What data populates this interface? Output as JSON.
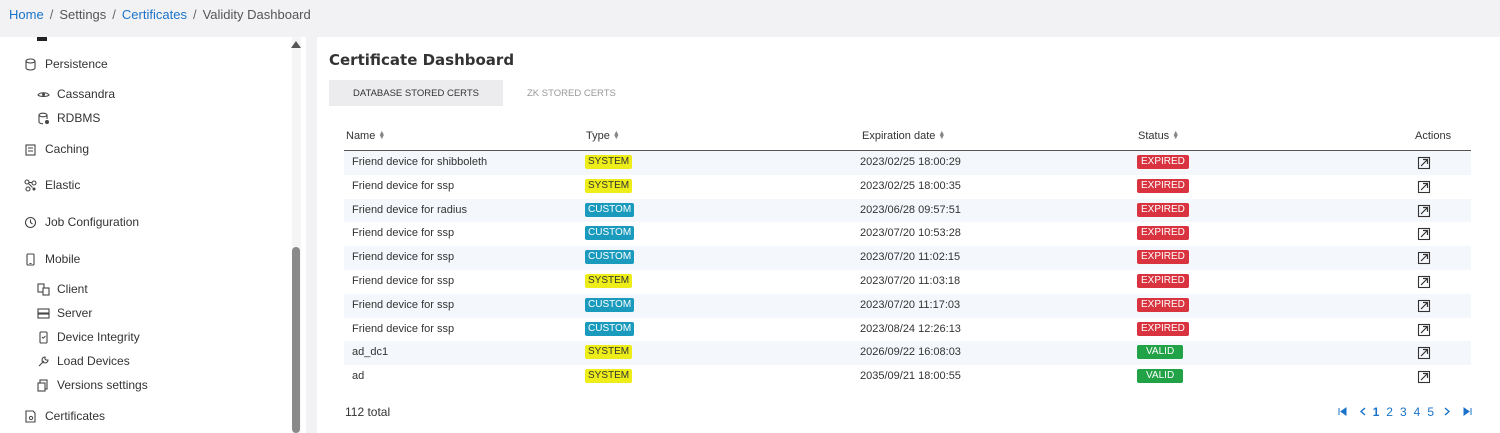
{
  "breadcrumb": {
    "home": "Home",
    "settings": "Settings",
    "certificates": "Certificates",
    "current": "Validity Dashboard",
    "separator": "/"
  },
  "sidebar": {
    "items": [
      {
        "label": "Persistence",
        "icon": "database-icon"
      },
      {
        "label": "Cassandra",
        "icon": "eye-icon"
      },
      {
        "label": "RDBMS",
        "icon": "rdbms-icon"
      },
      {
        "label": "Caching",
        "icon": "caching-icon"
      },
      {
        "label": "Elastic",
        "icon": "elastic-icon"
      },
      {
        "label": "Job Configuration",
        "icon": "clock-icon"
      },
      {
        "label": "Mobile",
        "icon": "mobile-icon"
      },
      {
        "label": "Client",
        "icon": "client-icon"
      },
      {
        "label": "Server",
        "icon": "server-icon"
      },
      {
        "label": "Device Integrity",
        "icon": "device-integrity-icon"
      },
      {
        "label": "Load Devices",
        "icon": "wrench-icon"
      },
      {
        "label": "Versions settings",
        "icon": "versions-icon"
      },
      {
        "label": "Certificates",
        "icon": "certificate-icon"
      }
    ]
  },
  "main": {
    "title": "Certificate Dashboard",
    "tabs": [
      {
        "label": "DATABASE STORED CERTS",
        "active": true
      },
      {
        "label": "ZK STORED CERTS",
        "active": false
      }
    ]
  },
  "table": {
    "headers": {
      "name": "Name",
      "type": "Type",
      "expiration": "Expiration date",
      "status": "Status",
      "actions": "Actions"
    },
    "rows": [
      {
        "name": "Friend device for shibboleth",
        "type": "SYSTEM",
        "expiration": "2023/02/25 18:00:29",
        "status": "EXPIRED"
      },
      {
        "name": "Friend device for ssp",
        "type": "SYSTEM",
        "expiration": "2023/02/25 18:00:35",
        "status": "EXPIRED"
      },
      {
        "name": "Friend device for radius",
        "type": "CUSTOM",
        "expiration": "2023/06/28 09:57:51",
        "status": "EXPIRED"
      },
      {
        "name": "Friend device for ssp",
        "type": "CUSTOM",
        "expiration": "2023/07/20 10:53:28",
        "status": "EXPIRED"
      },
      {
        "name": "Friend device for ssp",
        "type": "CUSTOM",
        "expiration": "2023/07/20 11:02:15",
        "status": "EXPIRED"
      },
      {
        "name": "Friend device for ssp",
        "type": "SYSTEM",
        "expiration": "2023/07/20 11:03:18",
        "status": "EXPIRED"
      },
      {
        "name": "Friend device for ssp",
        "type": "CUSTOM",
        "expiration": "2023/07/20 11:17:03",
        "status": "EXPIRED"
      },
      {
        "name": "Friend device for ssp",
        "type": "CUSTOM",
        "expiration": "2023/08/24 12:26:13",
        "status": "EXPIRED"
      },
      {
        "name": "ad_dc1",
        "type": "SYSTEM",
        "expiration": "2026/09/22 16:08:03",
        "status": "VALID"
      },
      {
        "name": "ad",
        "type": "SYSTEM",
        "expiration": "2035/09/21 18:00:55",
        "status": "VALID"
      }
    ]
  },
  "footer": {
    "total": "112 total",
    "pages": [
      "1",
      "2",
      "3",
      "4",
      "5"
    ],
    "current_page": "1"
  },
  "colors": {
    "link": "#1a73c8",
    "system": "#eded19",
    "custom": "#1a9bbd",
    "expired": "#d9333f",
    "valid": "#22a246"
  }
}
